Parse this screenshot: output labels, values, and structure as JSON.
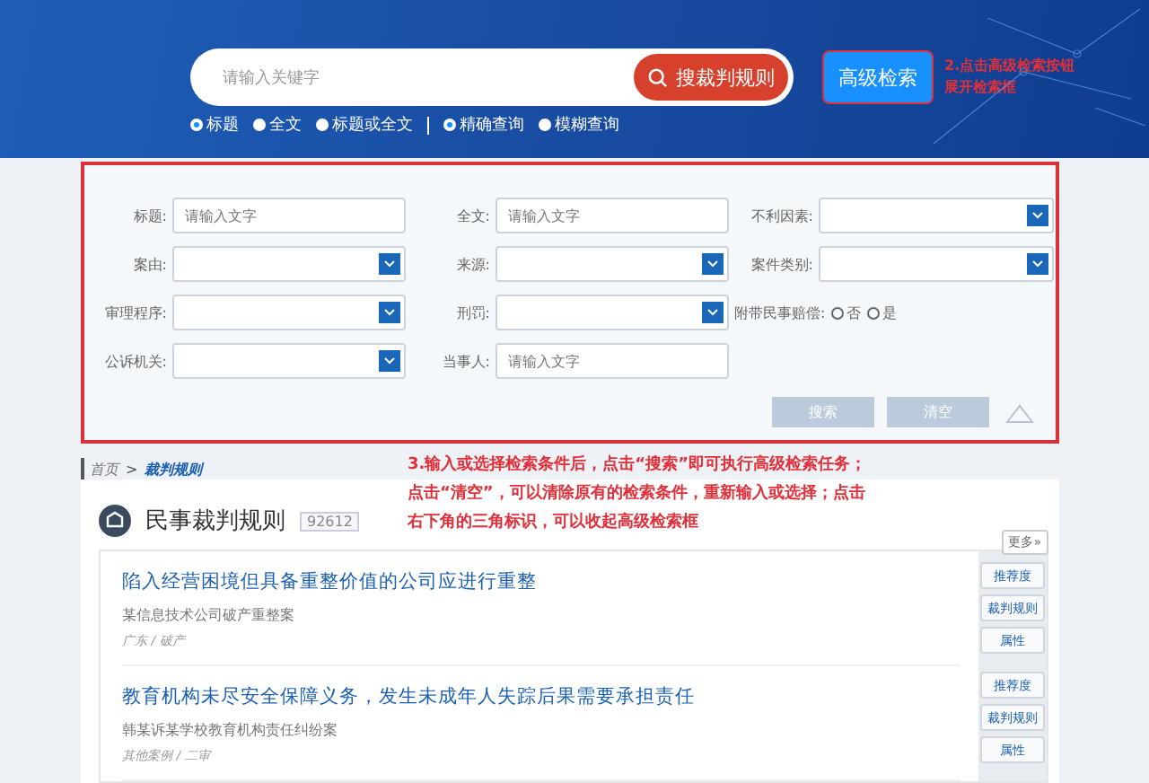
{
  "header": {
    "search": {
      "placeholder": "请输入关键字"
    },
    "search_button": "搜裁判规则",
    "advanced_button": "高级检索",
    "annotation": [
      "2.点击高级检索按钮",
      "展开检索框"
    ],
    "scope_options": [
      {
        "label": "标题",
        "selected": true
      },
      {
        "label": "全文",
        "selected": false
      },
      {
        "label": "标题或全文",
        "selected": false
      }
    ],
    "match_options": [
      {
        "label": "精确查询",
        "selected": true
      },
      {
        "label": "模糊查询",
        "selected": false
      }
    ]
  },
  "advanced_form": {
    "fields": [
      {
        "label": "标题:",
        "kind": "text",
        "placeholder": "请输入文字"
      },
      {
        "label": "全文:",
        "kind": "text",
        "placeholder": "请输入文字"
      },
      {
        "label": "不利因素:",
        "kind": "select"
      },
      {
        "label": "案由:",
        "kind": "select"
      },
      {
        "label": "来源:",
        "kind": "select"
      },
      {
        "label": "案件类别:",
        "kind": "select"
      },
      {
        "label": "审理程序:",
        "kind": "select"
      },
      {
        "label": "刑罚:",
        "kind": "select"
      },
      {
        "label": "附带民事赔偿:",
        "kind": "radio",
        "options": [
          {
            "label": "否",
            "selected": false
          },
          {
            "label": "是",
            "selected": false
          }
        ]
      },
      {
        "label": "公诉机关:",
        "kind": "select"
      },
      {
        "label": "当事人:",
        "kind": "text",
        "placeholder": "请输入文字"
      }
    ],
    "buttons": [
      "搜索",
      "清空"
    ]
  },
  "breadcrumb": {
    "home": "首页",
    "separator": ">",
    "current": "裁判规则"
  },
  "annotation": [
    "3.输入或选择检索条件后，点击“搜索”即可执行高级检索任务；",
    "点击“清空”，可以清除原有的检索条件，重新输入或选择；点击",
    "右下角的三角标识，可以收起高级检索框"
  ],
  "section": {
    "title": "民事裁判规则",
    "count": "92612",
    "more": "更多»"
  },
  "cases": [
    {
      "title": "陷入经营困境但具备重整价值的公司应进行重整",
      "subtitle": "某信息技术公司破产重整案",
      "meta": "广东 / 破产",
      "actions": [
        "推荐度",
        "裁判规则",
        "属性"
      ]
    },
    {
      "title": "教育机构未尽安全保障义务，发生未成年人失踪后果需要承担责任",
      "subtitle": "韩某诉某学校教育机构责任纠纷案",
      "meta": "其他案例 / 二审",
      "actions": [
        "推荐度",
        "裁判规则",
        "属性"
      ]
    }
  ]
}
